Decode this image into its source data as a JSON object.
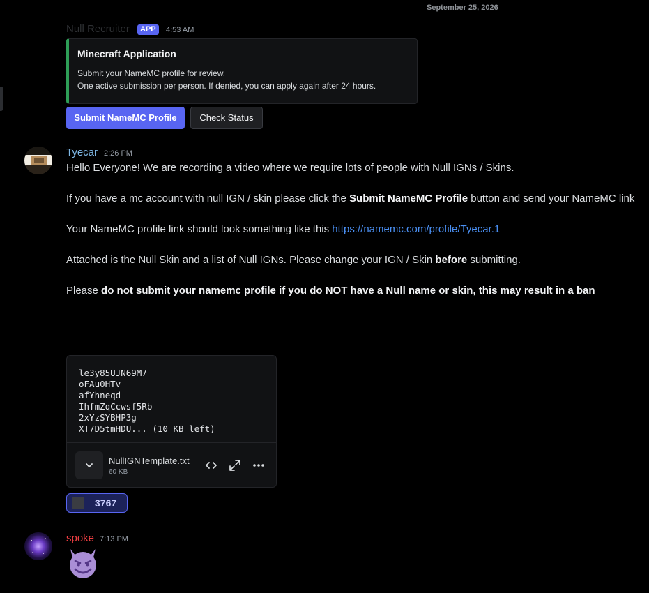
{
  "divider": {
    "date": "September 25, 2026"
  },
  "bot_message": {
    "author": "Null Recruiter",
    "badge": "APP",
    "time": "4:53 AM",
    "embed": {
      "title": "Minecraft Application",
      "line1": "Submit your NameMC profile for review.",
      "line2": "One active submission per person. If denied, you can apply again after 24 hours.",
      "accent_color": "#2e9e57"
    },
    "buttons": {
      "primary_label": "Submit NameMC Profile",
      "secondary_label": "Check Status"
    }
  },
  "message": {
    "author": "Tyecar",
    "time": "2:26 PM",
    "p1": "Hello Everyone! We are recording a video where we require lots of people with Null IGNs / Skins.",
    "p2_a": "If you have a mc account with null IGN / skin please click the ",
    "p2_bold": "Submit NameMC Profile",
    "p2_b": " button and send your NameMC link",
    "p3_a": "Your NameMC profile link should look something like this ",
    "p3_link": "https://namemc.com/profile/Tyecar.1",
    "p4_a": "Attached is the Null Skin and a list of Null IGNs. Please change your IGN / Skin ",
    "p4_bold": "before",
    "p4_b": " submitting.",
    "p5_a": "Please ",
    "p5_bold": "do not submit your namemc profile if you do NOT have a Null name or skin, this may result in a ban",
    "attachment": {
      "preview_lines": [
        "le3y85UJN69M7",
        "oFAu0HTv",
        "afYhneqd",
        "IhfmZqCcwsf5Rb",
        "2xYzSYBHP3g",
        "XT7D5tmHDU... (10 KB left)"
      ],
      "file_name": "NullIGNTemplate.txt",
      "file_size": "60 KB",
      "icons": [
        "download-icon",
        "code-icon",
        "expand-icon",
        "more-icon"
      ]
    },
    "reaction": {
      "count": "3767"
    }
  },
  "reply": {
    "author": "spoke",
    "time": "7:13 PM",
    "emoji": "smiling-imp-emoji"
  },
  "colors": {
    "background": "#000000",
    "brand": "#5865f2",
    "link": "#4a8ff2",
    "new_divider": "#f23f43",
    "author_tyecar": "#7fb8e6",
    "author_spoke": "#f23f43"
  }
}
